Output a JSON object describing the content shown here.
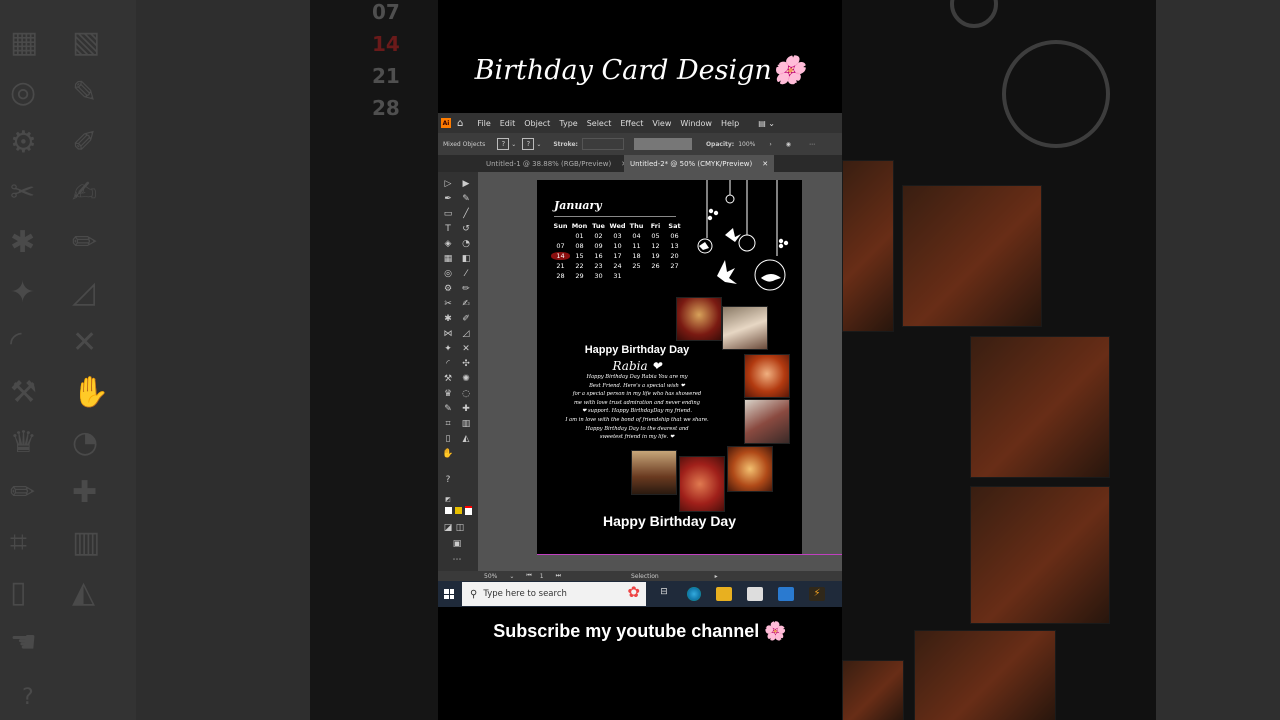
{
  "video": {
    "title": "Birthday Card Design🌸",
    "subtitle": "Subscribe my youtube channel 🌸"
  },
  "app": {
    "logo": "Ai",
    "menu": [
      "File",
      "Edit",
      "Object",
      "Type",
      "Select",
      "Effect",
      "View",
      "Window",
      "Help"
    ],
    "control_bar": {
      "selection_label": "Mixed Objects",
      "stroke_label": "Stroke:",
      "opacity_label": "Opacity:",
      "opacity_value": "100%"
    },
    "tabs": [
      {
        "label": "Untitled-1 @ 38.88% (RGB/Preview)",
        "active": false
      },
      {
        "label": "Untitled-2* @ 50% (CMYK/Preview)",
        "active": true
      }
    ],
    "status": {
      "zoom": "50%",
      "page": "1",
      "mode": "Selection"
    }
  },
  "card": {
    "month": "January",
    "weekdays": [
      "Sun",
      "Mon",
      "Tue",
      "Wed",
      "Thu",
      "Fri",
      "Sat"
    ],
    "weeks": [
      [
        "",
        "01",
        "02",
        "03",
        "04",
        "05",
        "06"
      ],
      [
        "07",
        "08",
        "09",
        "10",
        "11",
        "12",
        "13"
      ],
      [
        "14",
        "15",
        "16",
        "17",
        "18",
        "19",
        "20"
      ],
      [
        "21",
        "22",
        "23",
        "24",
        "25",
        "26",
        "27"
      ],
      [
        "28",
        "29",
        "30",
        "31",
        "",
        "",
        ""
      ]
    ],
    "highlighted_day": "14",
    "heading": "Happy Birthday Day",
    "name": "Rabia ❤",
    "message_lines": [
      "Happy Birthday Day Rabia You are my",
      "Best Friend. Here's a special wish ❤",
      "for a special person in my life who has showered",
      "me with love trust admiration and never ending",
      "❤ support. Happy BirthdayDay my friend.",
      "I am in love with the bond of friendship that we share.",
      "Happy Birthday Day to the dearest and",
      "sweetest friend in my life. ❤"
    ],
    "footer": "Happy Birthday Day"
  },
  "taskbar": {
    "search_placeholder": "Type here to search"
  },
  "colors": {
    "highlight_day": "#8a0f0f",
    "artboard": "#000000",
    "workspace": "#535353",
    "illustrator_orange": "#ff7c00"
  }
}
